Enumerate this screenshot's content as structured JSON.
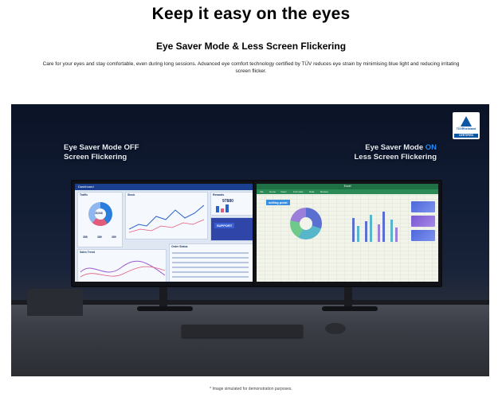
{
  "page": {
    "headline": "Keep it easy on the eyes",
    "subheadline": "Eye Saver Mode & Less Screen Flickering",
    "body": "Care for your eyes and stay comfortable, even during long sessions. Advanced eye comfort technology certified by TÜV reduces eye strain by minimising blue light and reducing irritating screen flicker.",
    "disclaimer": "* Image simulated for demonstration purposes."
  },
  "hero": {
    "left_overlay": {
      "line1": "Eye Saver Mode OFF",
      "line2": "Screen Flickering"
    },
    "right_overlay": {
      "line1_prefix": "Eye Saver Mode ",
      "line1_accent": "ON",
      "line2": "Less Screen Flickering"
    },
    "certification": {
      "brand": "TÜVRheinland",
      "label": "CERTIFIED"
    },
    "left_screen": {
      "title": "Dashboard",
      "card_traffic": "Traffic",
      "card_stock": "Stock",
      "card_rewards": "Rewards",
      "big_number": "97880",
      "donut_value": "35,546",
      "stat_a": "358",
      "stat_b": "389",
      "stat_c": "359",
      "support_label": "SUPPORT",
      "card_sales_trend": "Sales Trend",
      "card_order_status": "Order Status"
    },
    "right_screen": {
      "title": "Excel",
      "badge": "selling point",
      "tabs": [
        "File",
        "Home",
        "Insert",
        "Formulas",
        "Data",
        "Review"
      ]
    }
  },
  "colors": {
    "accent_blue": "#1f90ff",
    "text": "#000000",
    "excel_green": "#1f7145",
    "dashboard_blue": "#1b3f8f"
  }
}
